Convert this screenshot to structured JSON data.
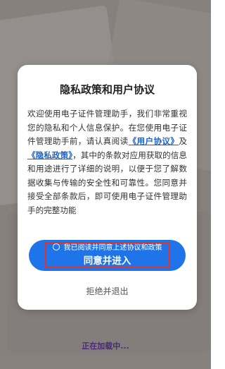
{
  "dialog": {
    "title": "隐私政策和用户协议",
    "body_part1": "欢迎使用电子证件管理助手，我们非常重视您的隐私和个人信息保护。在您使用电子证件管理助手前，请认真阅读",
    "user_agreement_link": "《用户协议》",
    "and_text": "及",
    "privacy_policy_link": "《隐私政策》",
    "body_part2": "，其中的条款对应用获取的信息和用途进行了详细的说明，以便于您了解数据收集与传输的安全性和可靠性。您同意并接受全部条款后，即可使用电子证件管理助手的完整功能",
    "consent_checkbox_label": "我已阅读并同意上述协议和政策",
    "agree_button": "同意并进入",
    "decline_button": "拒绝并退出"
  },
  "loading_text": "正在加载中...",
  "colors": {
    "accent": "#1e74e8",
    "link": "#1e63c9",
    "highlight_border": "#e0342b"
  }
}
